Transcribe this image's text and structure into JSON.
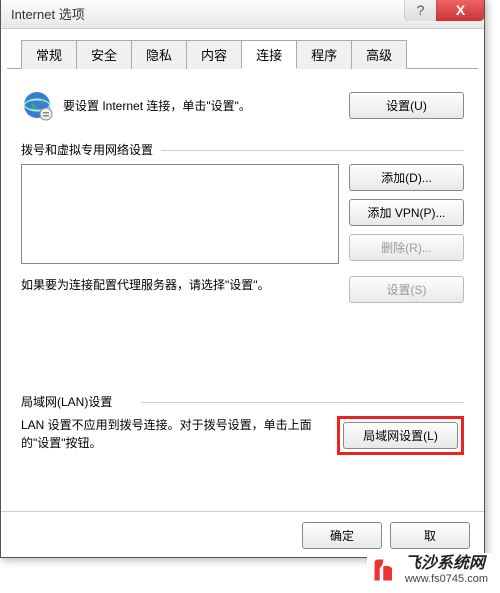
{
  "window": {
    "title": "Internet 选项",
    "help_symbol": "?",
    "close_symbol": "X"
  },
  "tabs": [
    "常规",
    "安全",
    "隐私",
    "内容",
    "连接",
    "程序",
    "高级"
  ],
  "active_tab_index": 4,
  "connect": {
    "setup_text": "要设置 Internet 连接，单击\"设置\"。",
    "setup_button": "设置(U)"
  },
  "dial_section": {
    "label": "拨号和虚拟专用网络设置",
    "add_button": "添加(D)...",
    "add_vpn_button": "添加 VPN(P)...",
    "remove_button": "删除(R)..."
  },
  "proxy_section": {
    "text": "如果要为连接配置代理服务器，请选择\"设置\"。",
    "settings_button": "设置(S)"
  },
  "lan_section": {
    "label": "局域网(LAN)设置",
    "text": "LAN 设置不应用到拨号连接。对于拨号设置，单击上面的\"设置\"按钮。",
    "lan_button": "局域网设置(L)"
  },
  "bottom": {
    "ok": "确定",
    "cancel_partial": "取"
  },
  "watermark": {
    "title": "飞沙系统网",
    "url": "www.fs0745.com"
  }
}
